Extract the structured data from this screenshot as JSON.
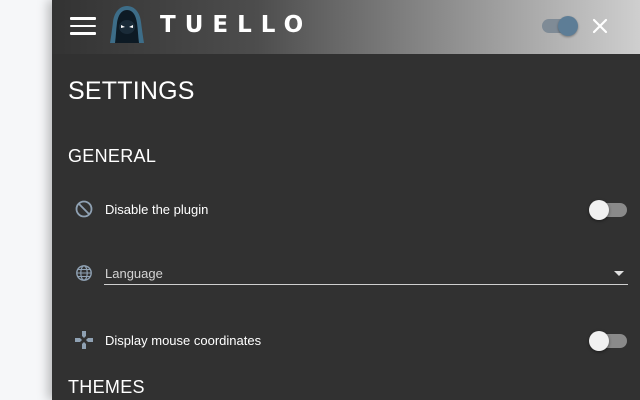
{
  "header": {
    "brand": "TUELLO",
    "menu_icon": "hamburger-menu-icon",
    "logo_icon": "hooded-ninja-logo",
    "toggle_state": "on",
    "close_icon": "close-icon"
  },
  "page": {
    "title": "SETTINGS"
  },
  "sections": {
    "general": {
      "title": "GENERAL",
      "disable_plugin": {
        "icon": "block-icon",
        "label": "Disable the plugin",
        "state": "off"
      },
      "language": {
        "icon": "globe-icon",
        "placeholder": "Language",
        "caret_icon": "caret-down-icon"
      },
      "mouse_coordinates": {
        "icon": "dpad-icon",
        "label": "Display mouse coordinates",
        "state": "off"
      }
    },
    "themes": {
      "title": "THEMES"
    }
  },
  "colors": {
    "panel_background": "#313131",
    "header_gradient_start": "#333333",
    "header_gradient_end": "#cfcfcf",
    "header_toggle_thumb": "#5d7d96",
    "icon_color": "#8fa1b3",
    "switch_track_off": "#8a8a8a",
    "switch_thumb_off": "#f1f1f1"
  }
}
